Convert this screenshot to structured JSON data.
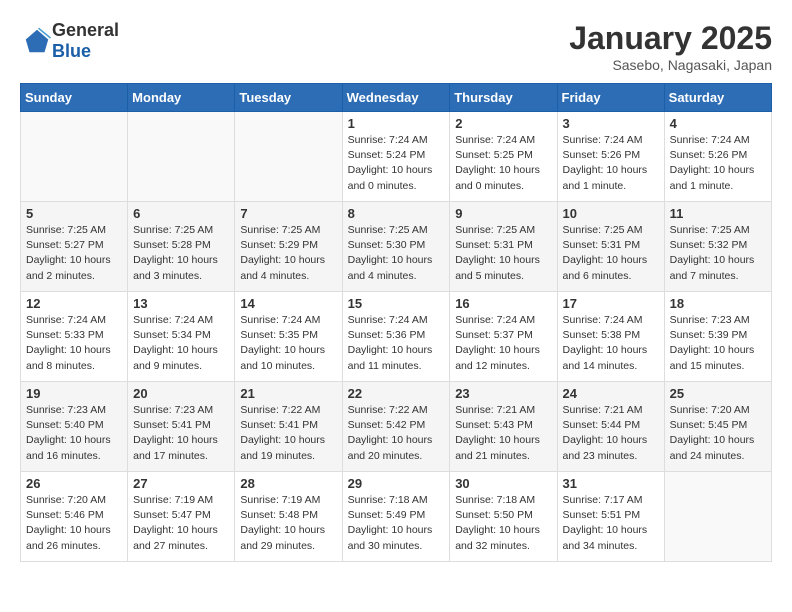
{
  "header": {
    "logo_general": "General",
    "logo_blue": "Blue",
    "title": "January 2025",
    "subtitle": "Sasebo, Nagasaki, Japan"
  },
  "days_of_week": [
    "Sunday",
    "Monday",
    "Tuesday",
    "Wednesday",
    "Thursday",
    "Friday",
    "Saturday"
  ],
  "weeks": [
    [
      {
        "day": "",
        "info": ""
      },
      {
        "day": "",
        "info": ""
      },
      {
        "day": "",
        "info": ""
      },
      {
        "day": "1",
        "info": "Sunrise: 7:24 AM\nSunset: 5:24 PM\nDaylight: 10 hours and 0 minutes."
      },
      {
        "day": "2",
        "info": "Sunrise: 7:24 AM\nSunset: 5:25 PM\nDaylight: 10 hours and 0 minutes."
      },
      {
        "day": "3",
        "info": "Sunrise: 7:24 AM\nSunset: 5:26 PM\nDaylight: 10 hours and 1 minute."
      },
      {
        "day": "4",
        "info": "Sunrise: 7:24 AM\nSunset: 5:26 PM\nDaylight: 10 hours and 1 minute."
      }
    ],
    [
      {
        "day": "5",
        "info": "Sunrise: 7:25 AM\nSunset: 5:27 PM\nDaylight: 10 hours and 2 minutes."
      },
      {
        "day": "6",
        "info": "Sunrise: 7:25 AM\nSunset: 5:28 PM\nDaylight: 10 hours and 3 minutes."
      },
      {
        "day": "7",
        "info": "Sunrise: 7:25 AM\nSunset: 5:29 PM\nDaylight: 10 hours and 4 minutes."
      },
      {
        "day": "8",
        "info": "Sunrise: 7:25 AM\nSunset: 5:30 PM\nDaylight: 10 hours and 4 minutes."
      },
      {
        "day": "9",
        "info": "Sunrise: 7:25 AM\nSunset: 5:31 PM\nDaylight: 10 hours and 5 minutes."
      },
      {
        "day": "10",
        "info": "Sunrise: 7:25 AM\nSunset: 5:31 PM\nDaylight: 10 hours and 6 minutes."
      },
      {
        "day": "11",
        "info": "Sunrise: 7:25 AM\nSunset: 5:32 PM\nDaylight: 10 hours and 7 minutes."
      }
    ],
    [
      {
        "day": "12",
        "info": "Sunrise: 7:24 AM\nSunset: 5:33 PM\nDaylight: 10 hours and 8 minutes."
      },
      {
        "day": "13",
        "info": "Sunrise: 7:24 AM\nSunset: 5:34 PM\nDaylight: 10 hours and 9 minutes."
      },
      {
        "day": "14",
        "info": "Sunrise: 7:24 AM\nSunset: 5:35 PM\nDaylight: 10 hours and 10 minutes."
      },
      {
        "day": "15",
        "info": "Sunrise: 7:24 AM\nSunset: 5:36 PM\nDaylight: 10 hours and 11 minutes."
      },
      {
        "day": "16",
        "info": "Sunrise: 7:24 AM\nSunset: 5:37 PM\nDaylight: 10 hours and 12 minutes."
      },
      {
        "day": "17",
        "info": "Sunrise: 7:24 AM\nSunset: 5:38 PM\nDaylight: 10 hours and 14 minutes."
      },
      {
        "day": "18",
        "info": "Sunrise: 7:23 AM\nSunset: 5:39 PM\nDaylight: 10 hours and 15 minutes."
      }
    ],
    [
      {
        "day": "19",
        "info": "Sunrise: 7:23 AM\nSunset: 5:40 PM\nDaylight: 10 hours and 16 minutes."
      },
      {
        "day": "20",
        "info": "Sunrise: 7:23 AM\nSunset: 5:41 PM\nDaylight: 10 hours and 17 minutes."
      },
      {
        "day": "21",
        "info": "Sunrise: 7:22 AM\nSunset: 5:41 PM\nDaylight: 10 hours and 19 minutes."
      },
      {
        "day": "22",
        "info": "Sunrise: 7:22 AM\nSunset: 5:42 PM\nDaylight: 10 hours and 20 minutes."
      },
      {
        "day": "23",
        "info": "Sunrise: 7:21 AM\nSunset: 5:43 PM\nDaylight: 10 hours and 21 minutes."
      },
      {
        "day": "24",
        "info": "Sunrise: 7:21 AM\nSunset: 5:44 PM\nDaylight: 10 hours and 23 minutes."
      },
      {
        "day": "25",
        "info": "Sunrise: 7:20 AM\nSunset: 5:45 PM\nDaylight: 10 hours and 24 minutes."
      }
    ],
    [
      {
        "day": "26",
        "info": "Sunrise: 7:20 AM\nSunset: 5:46 PM\nDaylight: 10 hours and 26 minutes."
      },
      {
        "day": "27",
        "info": "Sunrise: 7:19 AM\nSunset: 5:47 PM\nDaylight: 10 hours and 27 minutes."
      },
      {
        "day": "28",
        "info": "Sunrise: 7:19 AM\nSunset: 5:48 PM\nDaylight: 10 hours and 29 minutes."
      },
      {
        "day": "29",
        "info": "Sunrise: 7:18 AM\nSunset: 5:49 PM\nDaylight: 10 hours and 30 minutes."
      },
      {
        "day": "30",
        "info": "Sunrise: 7:18 AM\nSunset: 5:50 PM\nDaylight: 10 hours and 32 minutes."
      },
      {
        "day": "31",
        "info": "Sunrise: 7:17 AM\nSunset: 5:51 PM\nDaylight: 10 hours and 34 minutes."
      },
      {
        "day": "",
        "info": ""
      }
    ]
  ]
}
